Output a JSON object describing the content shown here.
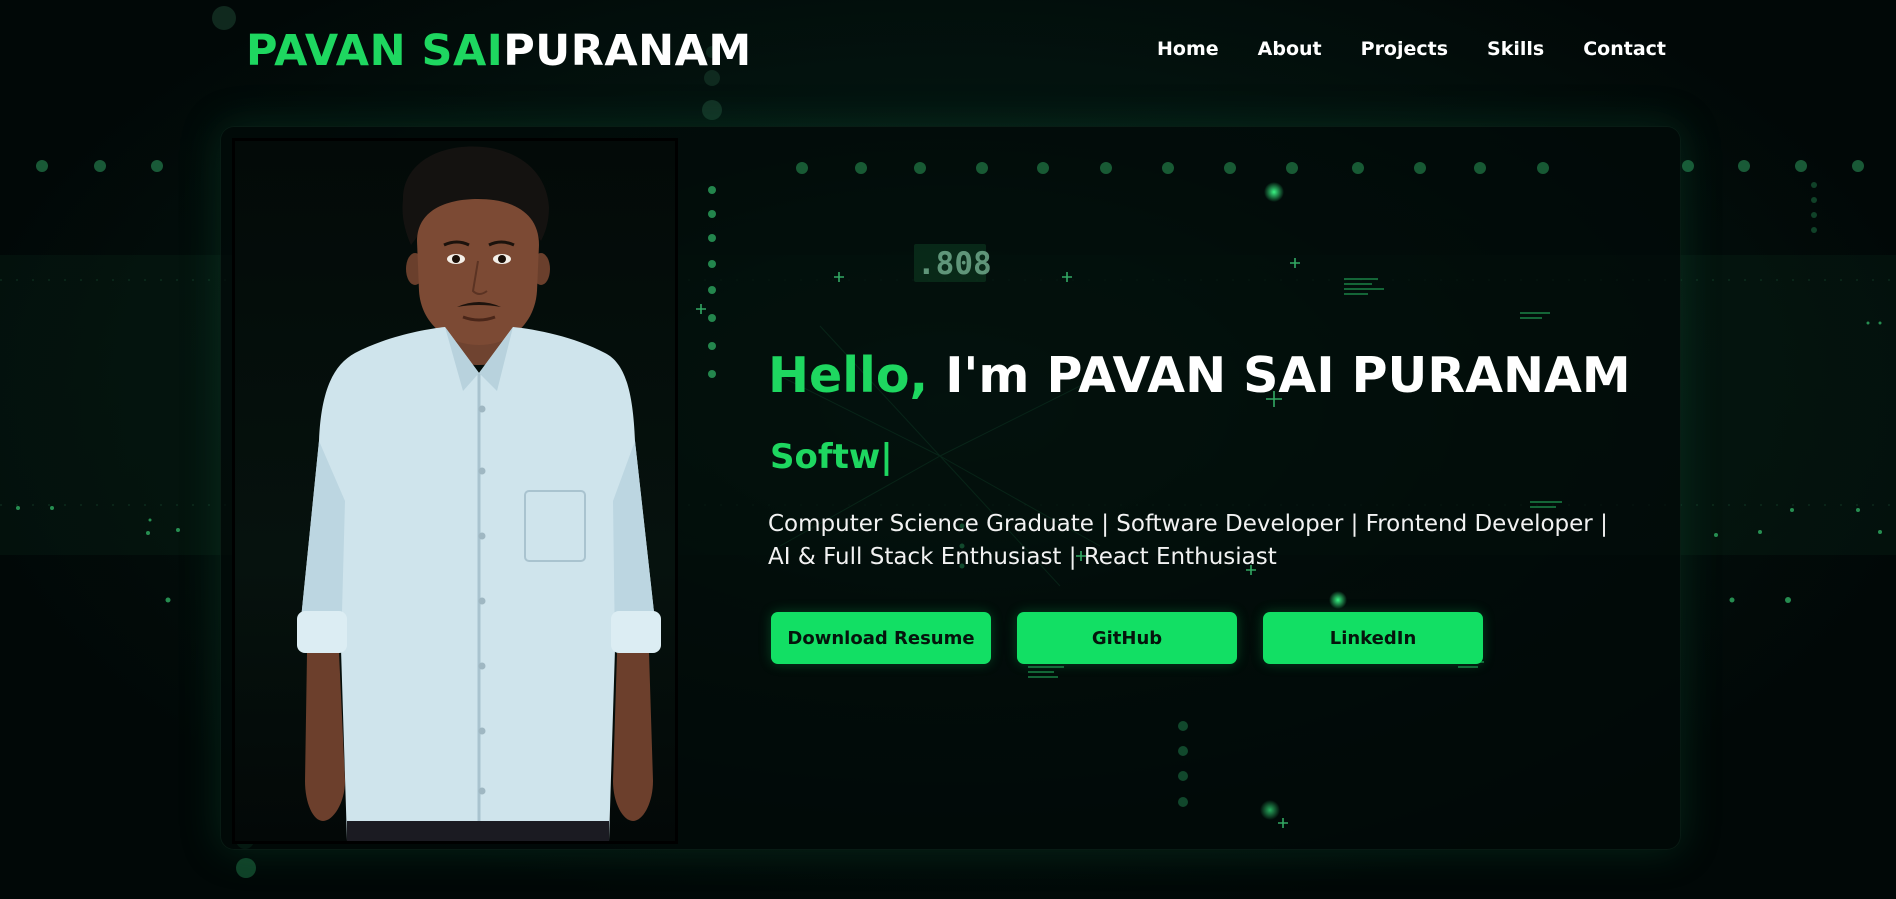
{
  "colors": {
    "accent": "#1ed760",
    "button": "#12df64",
    "background": "#010807",
    "text": "#ffffff"
  },
  "header": {
    "logo_first": "PAVAN SAI",
    "logo_last": "PURANAM",
    "nav": [
      "Home",
      "About",
      "Projects",
      "Skills",
      "Contact"
    ]
  },
  "hero": {
    "photo_icon": "profile-photo",
    "greeting": "Hello,",
    "intro": "I'm PAVAN SAI PURANAM",
    "typed_text": "Softw|",
    "tagline_line1": "Computer Science Graduate | Software Developer | Frontend Developer |",
    "tagline_line2": "AI & Full Stack Enthusiast | React Enthusiast",
    "buttons": {
      "resume": "Download Resume",
      "github": "GitHub",
      "linkedin": "LinkedIn"
    }
  },
  "background": {
    "display_text": ".808"
  }
}
